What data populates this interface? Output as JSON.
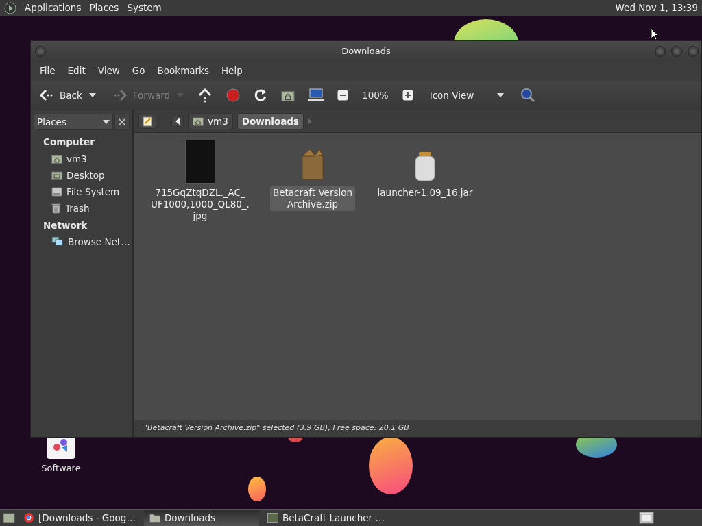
{
  "top_panel": {
    "menus": [
      "Applications",
      "Places",
      "System"
    ],
    "clock": "Wed Nov 1, 13:39"
  },
  "desktop_icons": [
    {
      "label": "Software"
    }
  ],
  "window": {
    "title": "Downloads",
    "menu": [
      "File",
      "Edit",
      "View",
      "Go",
      "Bookmarks",
      "Help"
    ],
    "toolbar": [
      {
        "kind": "back",
        "label": "Back",
        "disabled": false
      },
      {
        "kind": "forward",
        "label": "Forward",
        "disabled": true
      },
      {
        "kind": "up"
      },
      {
        "kind": "stop"
      },
      {
        "kind": "reload"
      },
      {
        "kind": "home"
      },
      {
        "kind": "computer"
      },
      {
        "kind": "zoom-out"
      },
      {
        "kind": "zoom-level",
        "label": "100%"
      },
      {
        "kind": "zoom-in"
      },
      {
        "kind": "view",
        "label": "Icon View"
      },
      {
        "kind": "search"
      }
    ],
    "sidebar_selector": "Places",
    "breadcrumbs": [
      {
        "label": "vm3",
        "kind": "home",
        "selected": false
      },
      {
        "label": "Downloads",
        "kind": "folder",
        "selected": true
      }
    ],
    "sidebar": [
      {
        "heading": "Computer",
        "items": [
          {
            "label": "vm3",
            "kind": "home"
          },
          {
            "label": "Desktop",
            "kind": "desktop"
          },
          {
            "label": "File System",
            "kind": "drive"
          },
          {
            "label": "Trash",
            "kind": "trash"
          }
        ]
      },
      {
        "heading": "Network",
        "items": [
          {
            "label": "Browse Net…",
            "kind": "network"
          }
        ]
      }
    ],
    "files": [
      {
        "kind": "image",
        "name_lines": [
          "715GqZtqDZL._AC_",
          "UF1000,1000_QL80_.",
          "jpg"
        ],
        "selected": false
      },
      {
        "kind": "archive",
        "name_lines": [
          "Betacraft Version",
          "Archive.zip"
        ],
        "selected": true
      },
      {
        "kind": "jar",
        "name_lines": [
          "launcher-1.09_16.jar"
        ],
        "selected": false
      }
    ],
    "status_bar": "\"Betacraft Version Archive.zip\" selected (3.9 GB), Free space: 20.1 GB"
  },
  "taskbar": [
    {
      "label": "[Downloads - Goog…",
      "kind": "browser",
      "selected": false
    },
    {
      "label": "Downloads",
      "kind": "folder",
      "selected": true
    },
    {
      "label": "BetaCraft Launcher …",
      "kind": "app",
      "selected": false
    }
  ]
}
